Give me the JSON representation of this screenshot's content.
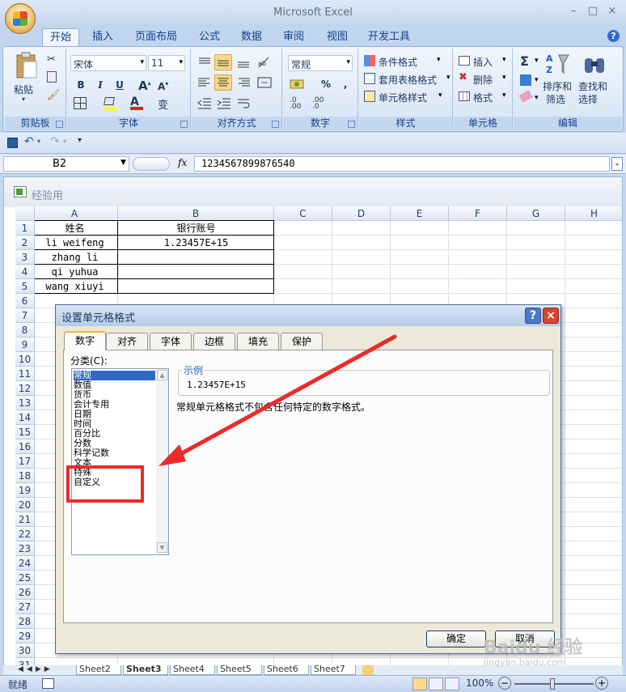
{
  "window": {
    "title": "Microsoft Excel",
    "minimize": "–",
    "restore": "□",
    "close": "×",
    "wb_minimize": "–",
    "wb_restore": "□",
    "wb_close": "×",
    "help": "?"
  },
  "ribbon_tabs": [
    "开始",
    "插入",
    "页面布局",
    "公式",
    "数据",
    "审阅",
    "视图",
    "开发工具"
  ],
  "ribbon": {
    "paste": "粘贴",
    "font_name": "宋体",
    "font_size": "11",
    "number_format": "常规",
    "conditional_format": "条件格式",
    "table_format": "套用表格格式",
    "cell_style": "单元格样式",
    "insert": "插入",
    "delete": "删除",
    "format": "格式",
    "sort_filter_1": "排序和",
    "sort_filter_2": "筛选",
    "find_select_1": "查找和",
    "find_select_2": "选择",
    "bold": "B",
    "italic": "I",
    "underline": "U",
    "percent": "%",
    "comma": ",",
    "sigma": "Σ",
    "groups": [
      "剪贴板",
      "字体",
      "对齐方式",
      "数字",
      "样式",
      "单元格",
      "编辑"
    ]
  },
  "formula_bar": {
    "name_box": "B2",
    "fx": "fx",
    "value": "1234567899876540"
  },
  "workbook": {
    "title": "经验用",
    "columns": [
      "A",
      "B",
      "C",
      "D",
      "E",
      "F",
      "G",
      "H"
    ],
    "rows": [
      "1",
      "2",
      "3",
      "4",
      "5",
      "6",
      "7",
      "8",
      "9",
      "10",
      "11",
      "12",
      "13",
      "14",
      "15",
      "16",
      "17",
      "18",
      "19",
      "20",
      "21",
      "22",
      "23",
      "24",
      "25",
      "26",
      "27",
      "28",
      "29",
      "30",
      "31"
    ],
    "cells": {
      "A1": "姓名",
      "B1": "银行账号",
      "A2": "li weifeng",
      "B2": "1.23457E+15",
      "A3": "zhang li",
      "A4": "qi yuhua",
      "A5": "wang xiuyi"
    },
    "sheet_tabs": [
      "Sheet2",
      "Sheet3",
      "Sheet4",
      "Sheet5",
      "Sheet6",
      "Sheet7"
    ]
  },
  "status_bar": {
    "mode": "就绪",
    "zoom": "100%",
    "zoom_minus": "−",
    "zoom_plus": "+"
  },
  "dialog": {
    "title": "设置单元格格式",
    "help": "?",
    "close": "×",
    "tabs": [
      "数字",
      "对齐",
      "字体",
      "边框",
      "填充",
      "保护"
    ],
    "category_label": "分类(C):",
    "categories": [
      "常规",
      "数值",
      "货币",
      "会计专用",
      "日期",
      "时间",
      "百分比",
      "分数",
      "科学记数",
      "文本",
      "特殊",
      "自定义"
    ],
    "selected_category": "常规",
    "sample_label": "示例",
    "sample_value": "1.23457E+15",
    "description": "常规单元格格式不包含任何特定的数字格式。",
    "ok": "确定",
    "cancel": "取消"
  },
  "watermark": {
    "brand": "Baidu 经验",
    "url": "jingyan.baidu.com"
  },
  "colors": {
    "ribbon_blue": "#c2d5ee",
    "accent_red": "#ec2a2a",
    "selection_blue": "#316ac5"
  }
}
